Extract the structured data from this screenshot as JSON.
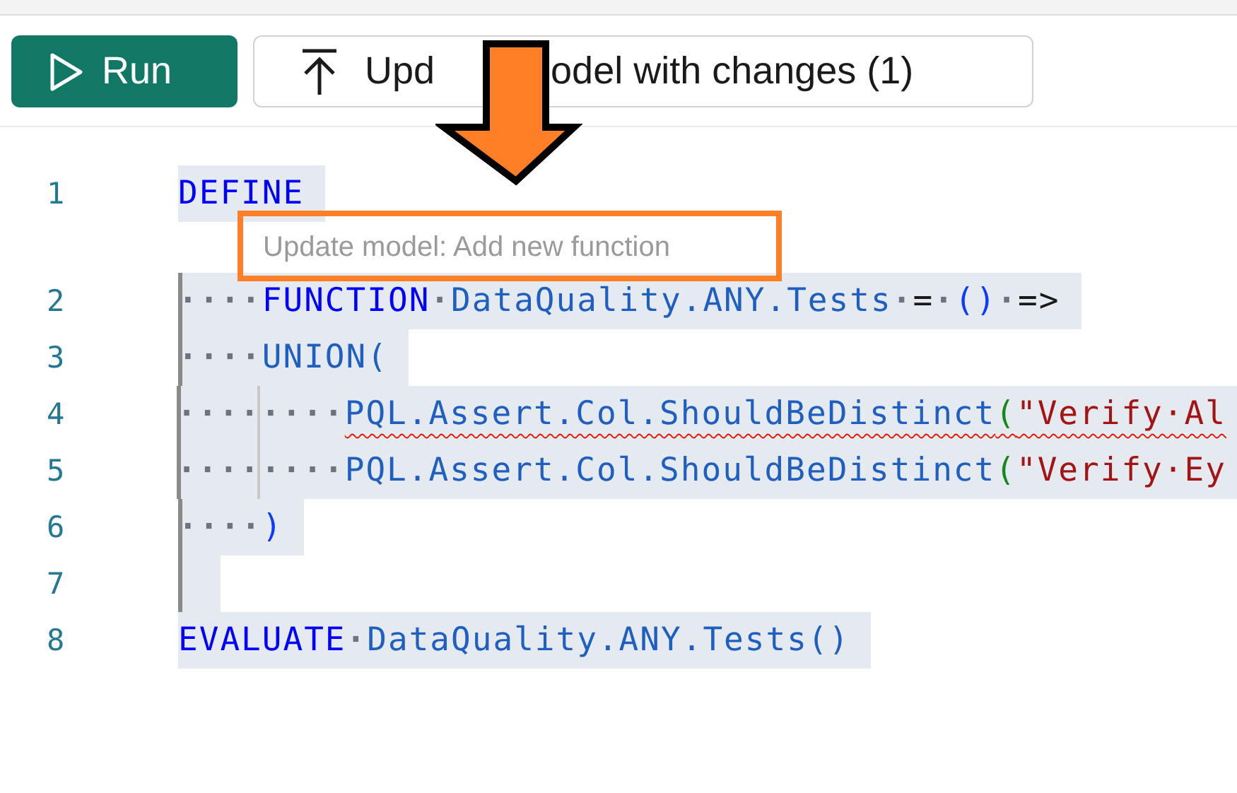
{
  "toolbar": {
    "run_button": "Run",
    "update_button": {
      "label_start": "Upd",
      "label_end": "odel with changes (1)"
    }
  },
  "editor": {
    "lines": [
      {
        "number": "1",
        "guide": false,
        "selected": true,
        "hint": "Update model: Add new function",
        "tokens": [
          {
            "kind": "kw",
            "text": "DEFINE"
          }
        ]
      },
      {
        "number": "2",
        "guide": true,
        "selected": true,
        "tokens": [
          {
            "kind": "ws",
            "text": "····"
          },
          {
            "kind": "kw",
            "text": "FUNCTION"
          },
          {
            "kind": "ws",
            "text": "·"
          },
          {
            "kind": "id",
            "text": "DataQuality.ANY.Tests"
          },
          {
            "kind": "ws",
            "text": "·"
          },
          {
            "kind": "op",
            "text": "="
          },
          {
            "kind": "ws",
            "text": "·"
          },
          {
            "kind": "paren",
            "text": "()"
          },
          {
            "kind": "ws",
            "text": "·"
          },
          {
            "kind": "op",
            "text": "=>"
          }
        ]
      },
      {
        "number": "3",
        "guide": true,
        "selected": true,
        "tokens": [
          {
            "kind": "ws",
            "text": "····"
          },
          {
            "kind": "id",
            "text": "UNION("
          }
        ]
      },
      {
        "number": "4",
        "guide": true,
        "selected": true,
        "squiggle": true,
        "tokens": [
          {
            "kind": "ws",
            "text": "····"
          },
          {
            "kind": "ws",
            "text": "····",
            "guide": true
          },
          {
            "kind": "id",
            "text": "PQL.Assert.Col.ShouldBeDistinct"
          },
          {
            "kind": "gparen",
            "text": "("
          },
          {
            "kind": "str",
            "text": "\"Verify·Al"
          }
        ]
      },
      {
        "number": "5",
        "guide": true,
        "selected": true,
        "squiggle": false,
        "tokens": [
          {
            "kind": "ws",
            "text": "····"
          },
          {
            "kind": "ws",
            "text": "····",
            "guide": true
          },
          {
            "kind": "id",
            "text": "PQL.Assert.Col.ShouldBeDistinct"
          },
          {
            "kind": "gparen",
            "text": "("
          },
          {
            "kind": "str",
            "text": "\"Verify·Ey"
          }
        ]
      },
      {
        "number": "6",
        "guide": true,
        "selected": true,
        "tokens": [
          {
            "kind": "ws",
            "text": "····"
          },
          {
            "kind": "paren",
            "text": ")"
          }
        ]
      },
      {
        "number": "7",
        "guide": true,
        "selected": true
      },
      {
        "number": "8",
        "guide": false,
        "selected": true,
        "tokens": [
          {
            "kind": "kw",
            "text": "EVALUATE"
          },
          {
            "kind": "ws",
            "text": "·"
          },
          {
            "kind": "id",
            "text": "DataQuality.ANY.Tests()"
          }
        ]
      }
    ]
  }
}
